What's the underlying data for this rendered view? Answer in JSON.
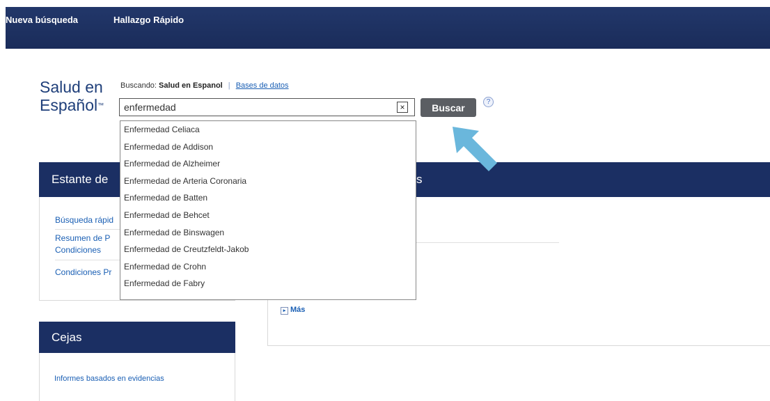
{
  "topbar": {
    "new_search": "Nueva búsqueda",
    "quick_find": "Hallazgo Rápido"
  },
  "logo": {
    "line1": "Salud en",
    "line2": "Español",
    "tm": "™"
  },
  "searching": {
    "prefix": "Buscando:",
    "database": "Salud en Espanol",
    "separator": "|",
    "databases_link": "Bases de datos"
  },
  "search": {
    "value": "enfermedad",
    "clear_symbol": "×",
    "button_label": "Buscar",
    "help_symbol": "?"
  },
  "suggestions": [
    "Enfermedad Celiaca",
    "Enfermedad de Addison",
    "Enfermedad de Alzheimer",
    "Enfermedad de Arteria Coronaria",
    "Enfermedad de Batten",
    "Enfermedad de Behcet",
    "Enfermedad de Binswagen",
    "Enfermedad de Creutzfeldt-Jakob",
    "Enfermedad de Crohn",
    "Enfermedad de Fabry"
  ],
  "left_panel": {
    "title": "Estante de",
    "links": [
      "Búsqueda rápid",
      "Resumen de P",
      "Condiciones",
      "Condiciones Pr"
    ]
  },
  "right_panel": {
    "title_fragment": "s",
    "more_label": "Más",
    "more_icon": "plus-box-icon"
  },
  "cejas": {
    "title": "Cejas",
    "link": "Informes basados en evidencias"
  },
  "colors": {
    "topbar": "#1f3366",
    "panel_header": "#1b2f63",
    "button": "#5b5e63",
    "link": "#1a5fb4",
    "arrow": "#6ab7dc"
  }
}
